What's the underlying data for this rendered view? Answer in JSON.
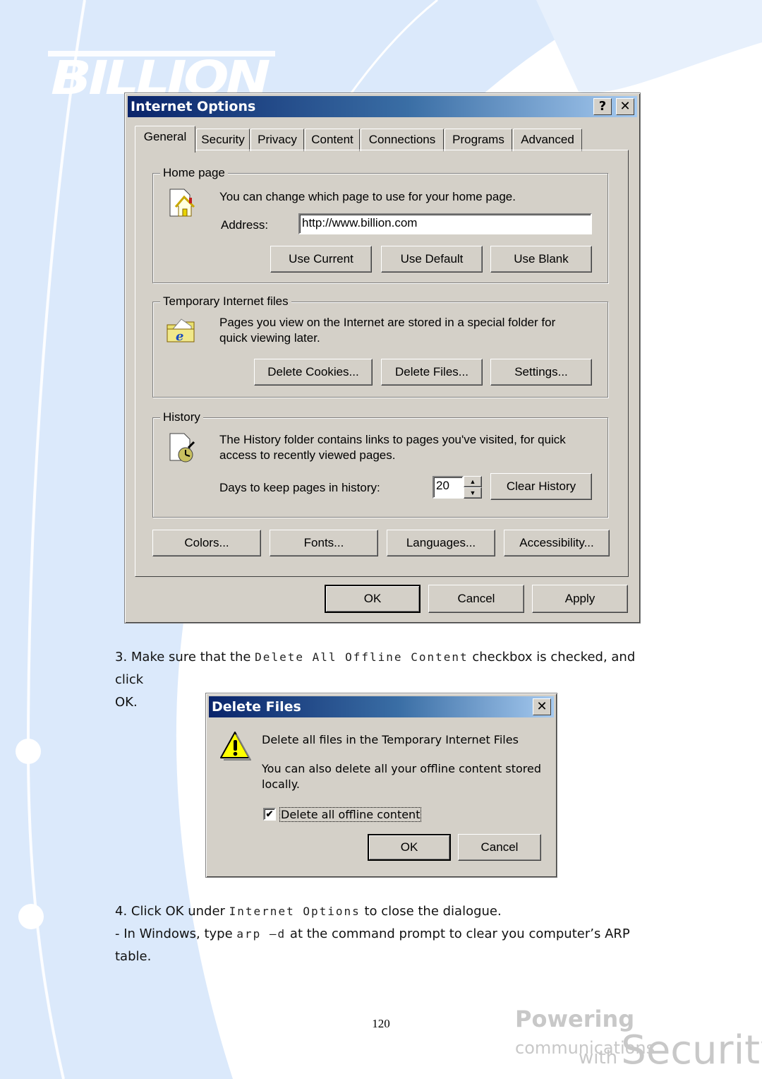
{
  "brand": {
    "logo_text": "BILLION",
    "slogan_line1_bold": "Powering",
    "slogan_line1_rest": "communications",
    "slogan_with": "with",
    "slogan_security": "Security"
  },
  "internet_options": {
    "title": "Internet Options",
    "help_glyph": "?",
    "close_glyph": "✕",
    "tabs": [
      {
        "label": "General",
        "active": true
      },
      {
        "label": "Security"
      },
      {
        "label": "Privacy"
      },
      {
        "label": "Content"
      },
      {
        "label": "Connections"
      },
      {
        "label": "Programs"
      },
      {
        "label": "Advanced"
      }
    ],
    "home_page": {
      "group_title": "Home page",
      "icon": "home-page-icon",
      "description": "You can change which page to use for your home page.",
      "address_label": "Address:",
      "address_value": "http://www.billion.com",
      "buttons": [
        "Use Current",
        "Use Default",
        "Use Blank"
      ]
    },
    "temp_files": {
      "group_title": "Temporary Internet files",
      "icon": "ie-folder-icon",
      "description_line1": "Pages you view on the Internet are stored in a special folder for",
      "description_line2": "quick viewing later.",
      "buttons": [
        "Delete Cookies...",
        "Delete Files...",
        "Settings..."
      ]
    },
    "history": {
      "group_title": "History",
      "icon": "history-icon",
      "description_line1": "The History folder contains links to pages you've visited, for quick",
      "description_line2": "access to recently viewed pages.",
      "days_label": "Days to keep pages in history:",
      "days_value": "20",
      "clear_button": "Clear History"
    },
    "bottom_buttons": [
      "Colors...",
      "Fonts...",
      "Languages...",
      "Accessibility..."
    ],
    "dialog_buttons": [
      "OK",
      "Cancel",
      "Apply"
    ]
  },
  "step3": {
    "prefix": "3. Make sure that the ",
    "code": "Delete All Offline Content",
    "suffix": " checkbox is checked, and click",
    "line2": "OK."
  },
  "delete_files": {
    "title": "Delete Files",
    "close_glyph": "✕",
    "icon": "warning-icon",
    "message1": "Delete all files in the Temporary Internet Files",
    "message2_line1": "You can also delete all your offline content stored",
    "message2_line2": "locally.",
    "checkbox_label": "Delete all offline content",
    "checkbox_checked": true,
    "buttons": [
      "OK",
      "Cancel"
    ]
  },
  "step4": {
    "prefix": "4. Click OK under ",
    "code": "Internet Options",
    "suffix": " to close the dialogue.",
    "note_prefix": "- In Windows, type ",
    "note_code": "arp –d",
    "note_suffix": " at the command prompt to clear you computer’s ARP",
    "note_line2": "table."
  },
  "page_number": "120"
}
